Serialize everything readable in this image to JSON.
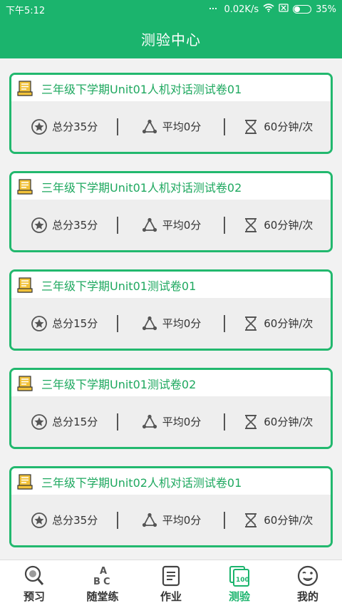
{
  "status": {
    "time": "下午5:12",
    "network_speed": "0.02K/s",
    "battery_percent": "35%",
    "battery_level": 0.35
  },
  "header": {
    "title": "测验中心"
  },
  "quizzes": [
    {
      "title": "三年级下学期Unit01人机对话测试卷01",
      "total": "总分35分",
      "average": "平均0分",
      "duration": "60分钟/次"
    },
    {
      "title": "三年级下学期Unit01人机对话测试卷02",
      "total": "总分35分",
      "average": "平均0分",
      "duration": "60分钟/次"
    },
    {
      "title": "三年级下学期Unit01测试卷01",
      "total": "总分15分",
      "average": "平均0分",
      "duration": "60分钟/次"
    },
    {
      "title": "三年级下学期Unit01测试卷02",
      "total": "总分15分",
      "average": "平均0分",
      "duration": "60分钟/次"
    },
    {
      "title": "三年级下学期Unit02人机对话测试卷01",
      "total": "总分35分",
      "average": "平均0分",
      "duration": "60分钟/次"
    }
  ],
  "tabs": [
    {
      "label": "预习",
      "icon": "magnifier-icon"
    },
    {
      "label": "随堂练",
      "icon": "abc-icon"
    },
    {
      "label": "作业",
      "icon": "document-icon"
    },
    {
      "label": "测验",
      "icon": "test-100-icon",
      "active": true
    },
    {
      "label": "我的",
      "icon": "smiley-icon"
    }
  ],
  "colors": {
    "brand": "#1bb46d",
    "card_border": "#22b86e",
    "title_text": "#1ea85f"
  }
}
